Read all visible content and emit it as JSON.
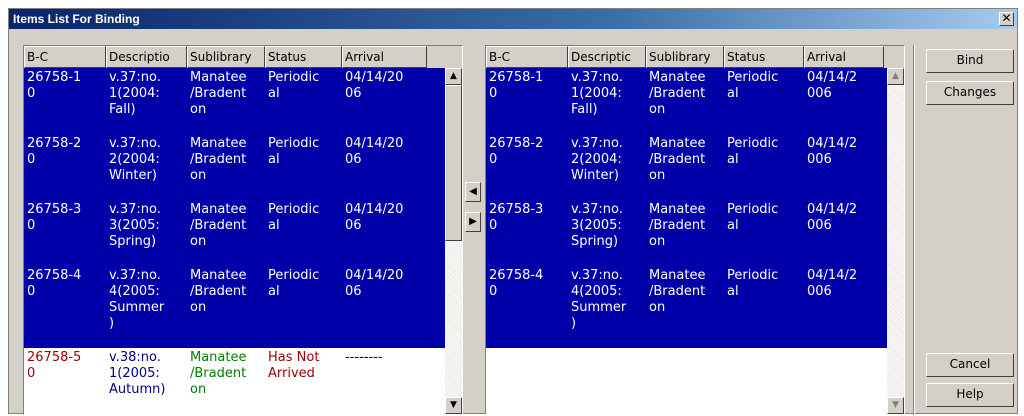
{
  "window": {
    "title": "Items List For Binding",
    "close_glyph": "✕"
  },
  "columns": [
    "B-C",
    "Descriptio",
    "Sublibrary",
    "Status",
    "Arrival"
  ],
  "right_columns": [
    "B-C",
    "Descriptic",
    "Sublibrary",
    "Status",
    "Arrival"
  ],
  "left_list": {
    "rows": [
      {
        "selected": true,
        "bc": "26758-1\n0",
        "desc": "v.37:no.\n1(2004:\nFall)",
        "sub": "Manatee\n/Bradent\non",
        "status": "Periodic\nal",
        "arrival": "04/14/20\n06"
      },
      {
        "selected": true,
        "bc": "26758-2\n0",
        "desc": "v.37:no.\n2(2004:\nWinter)",
        "sub": "Manatee\n/Bradent\non",
        "status": "Periodic\nal",
        "arrival": "04/14/20\n06"
      },
      {
        "selected": true,
        "bc": "26758-3\n0",
        "desc": "v.37:no.\n3(2005:\nSpring)",
        "sub": "Manatee\n/Bradent\non",
        "status": "Periodic\nal",
        "arrival": "04/14/20\n06"
      },
      {
        "selected": true,
        "bc": "26758-4\n0",
        "desc": "v.37:no.\n4(2005:\nSummer\n)",
        "sub": "Manatee\n/Bradent\non",
        "status": "Periodic\nal",
        "arrival": "04/14/20\n06"
      },
      {
        "selected": false,
        "bc": "26758-5\n0",
        "desc": "v.38:no.\n1(2005:\nAutumn)",
        "sub": "Manatee\n/Bradent\non",
        "status": "Has Not\nArrived",
        "arrival": "--------"
      }
    ]
  },
  "right_list": {
    "rows": [
      {
        "selected": true,
        "bc": "26758-1\n0",
        "desc": "v.37:no.\n1(2004:\nFall)",
        "sub": "Manatee\n/Bradent\non",
        "status": "Periodic\nal",
        "arrival": "04/14/2\n006"
      },
      {
        "selected": true,
        "bc": "26758-2\n0",
        "desc": "v.37:no.\n2(2004:\nWinter)",
        "sub": "Manatee\n/Bradent\non",
        "status": "Periodic\nal",
        "arrival": "04/14/2\n006"
      },
      {
        "selected": true,
        "bc": "26758-3\n0",
        "desc": "v.37:no.\n3(2005:\nSpring)",
        "sub": "Manatee\n/Bradent\non",
        "status": "Periodic\nal",
        "arrival": "04/14/2\n006"
      },
      {
        "selected": true,
        "bc": "26758-4\n0",
        "desc": "v.37:no.\n4(2005:\nSummer\n)",
        "sub": "Manatee\n/Bradent\non",
        "status": "Periodic\nal",
        "arrival": "04/14/2\n006"
      }
    ]
  },
  "transfer": {
    "move_left_icon": "triangle-left-icon",
    "move_right_icon": "triangle-right-icon"
  },
  "buttons": {
    "bind": "Bind",
    "changes": "Changes",
    "cancel": "Cancel",
    "help": "Help"
  },
  "colors": {
    "selection_bg": "#0000a8",
    "selection_fg": "#ffffff",
    "unarrived_bc": "#a00000",
    "unarrived_desc": "#000080",
    "unarrived_sub": "#008000",
    "unarrived_status": "#a00000"
  }
}
